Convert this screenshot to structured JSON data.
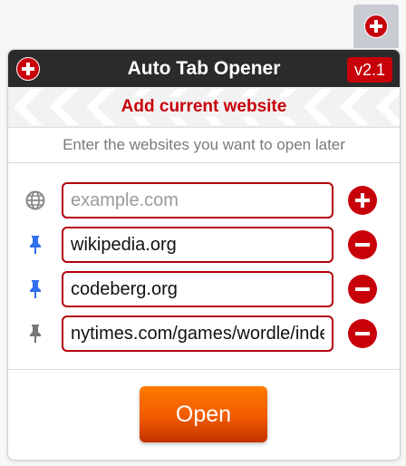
{
  "toolbar": {
    "icon": "plus-circle-icon"
  },
  "header": {
    "title": "Auto Tab Opener",
    "version": "v2.1",
    "logo_icon": "plus-circle-icon"
  },
  "add_current": {
    "label": "Add current website"
  },
  "hint": "Enter the websites you want to open later",
  "sites": [
    {
      "value": "",
      "placeholder": "example.com",
      "icon": "globe-icon",
      "icon_color": "#888888",
      "action": "add"
    },
    {
      "value": "wikipedia.org",
      "placeholder": "",
      "icon": "pin-icon",
      "icon_color": "#2f6ff0",
      "action": "remove"
    },
    {
      "value": "codeberg.org",
      "placeholder": "",
      "icon": "pin-icon",
      "icon_color": "#2f6ff0",
      "action": "remove"
    },
    {
      "value": "nytimes.com/games/wordle/index.html",
      "placeholder": "",
      "icon": "pin-icon",
      "icon_color": "#777777",
      "action": "remove"
    }
  ],
  "open_button": {
    "label": "Open"
  },
  "colors": {
    "accent_red": "#c8000a",
    "header_bg": "#2b2b2b",
    "open_orange": "#f05a00"
  }
}
